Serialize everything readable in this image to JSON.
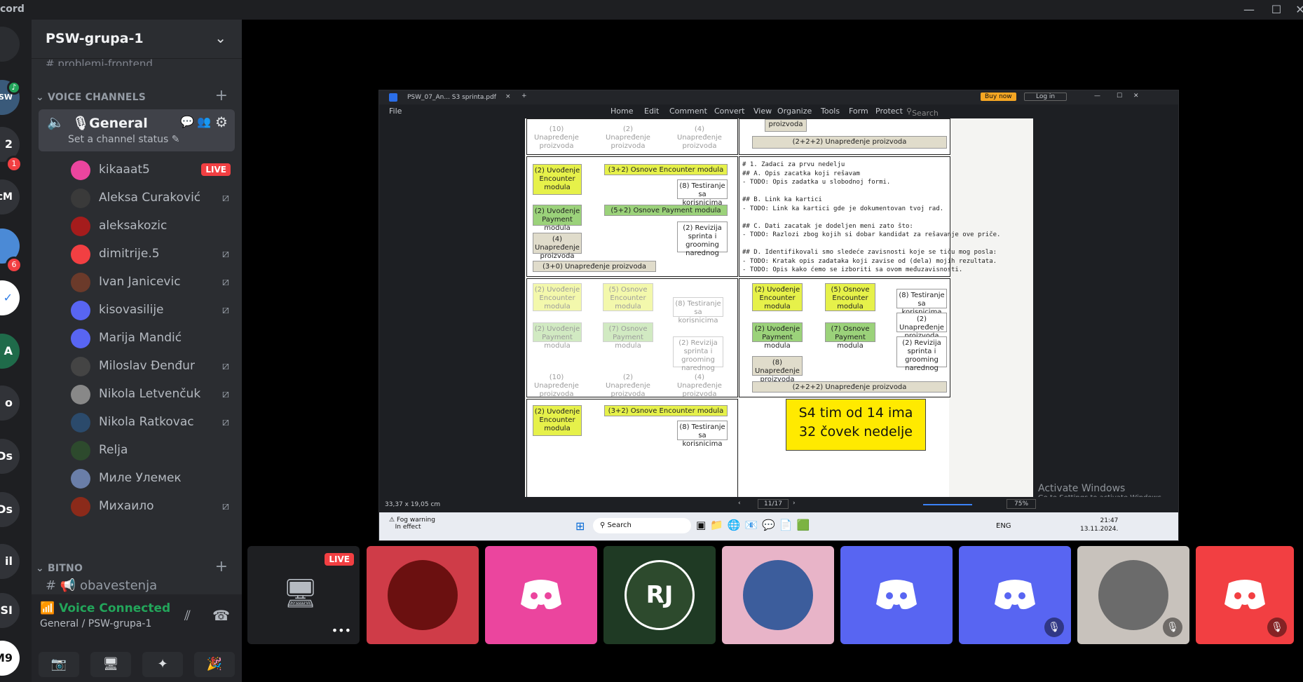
{
  "app": {
    "title": "cord"
  },
  "window_controls": {
    "min": "—",
    "max": "☐",
    "close": "✕"
  },
  "servers": [
    {
      "label": "SW",
      "badge": ""
    },
    {
      "label": "2",
      "badge": "1"
    },
    {
      "label": "McM",
      "badge": ""
    },
    {
      "label": "",
      "badge": "6"
    },
    {
      "label": "",
      "badge": ""
    },
    {
      "label": "A",
      "badge": ""
    },
    {
      "label": "o",
      "badge": ""
    },
    {
      "label": "Ds",
      "badge": ""
    },
    {
      "label": "Ds",
      "badge": ""
    },
    {
      "label": "il",
      "badge": ""
    },
    {
      "label": "SI",
      "badge": ""
    },
    {
      "label": "M9",
      "badge": ""
    }
  ],
  "guild": {
    "name": "PSW-grupa-1",
    "partial_channel": "problemi-frontend"
  },
  "voice_category": "VOICE CHANNELS",
  "voice_channel": {
    "name": "General",
    "status_placeholder": "Set a channel status"
  },
  "members": [
    {
      "name": "kikaaat5",
      "live": "LIVE",
      "muted": false,
      "color": "#eb459e"
    },
    {
      "name": "Aleksa Curaković",
      "live": "",
      "muted": true,
      "color": "#3a3a3a"
    },
    {
      "name": "aleksakozic",
      "live": "",
      "muted": false,
      "color": "#a51c1c"
    },
    {
      "name": "dimitrije.5",
      "live": "",
      "muted": true,
      "color": "#f23f42"
    },
    {
      "name": "Ivan Janicevic",
      "live": "",
      "muted": true,
      "color": "#6b3a2a"
    },
    {
      "name": "kisovasilije",
      "live": "",
      "muted": true,
      "color": "#5865f2"
    },
    {
      "name": "Marija Mandić",
      "live": "",
      "muted": false,
      "color": "#5865f2"
    },
    {
      "name": "Miloslav Đenđur",
      "live": "",
      "muted": true,
      "color": "#444"
    },
    {
      "name": "Nikola Letvenčuk",
      "live": "",
      "muted": true,
      "color": "#888"
    },
    {
      "name": "Nikola Ratkovac",
      "live": "",
      "muted": true,
      "color": "#2b4a6b"
    },
    {
      "name": "Relja",
      "live": "",
      "muted": false,
      "color": "#2d4a2d"
    },
    {
      "name": "Миле Улемек",
      "live": "",
      "muted": false,
      "color": "#6a7ea8"
    },
    {
      "name": "Михаило",
      "live": "",
      "muted": true,
      "color": "#8b2a1a"
    }
  ],
  "bitno_category": "BITNO",
  "bitno_channel": "obavestenja",
  "voice_panel": {
    "title": "Voice Connected",
    "subtitle": "General / PSW-grupa-1"
  },
  "pdf": {
    "tab_title": "PSW_07_An... S3 sprinta.pdf",
    "buy": "Buy now",
    "login": "Log in",
    "file_menu": "File",
    "menu": [
      "Home",
      "Edit",
      "Comment",
      "Convert",
      "View",
      "Organize",
      "Tools",
      "Form",
      "Protect"
    ],
    "search_tools": "Search Tools",
    "dims": "33,37 x 19,05 cm",
    "page": "11/17",
    "zoom": "75%",
    "code_lines": [
      "# 1. Zadaci za prvu nedelju",
      "## A. Opis zacatka koji rešavam",
      "- TODO: Opis zadatka u slobodnoj formi.",
      "",
      "## B. Link ka kartici",
      "- TODO: Link ka kartici gde je dokumentovan tvoj rad.",
      "",
      "## C. Dati zacatak je dodeljen meni zato što:",
      "- TODO: Razlozi zbog kojih si dobar kandidat za rešavanje ove priče.",
      "",
      "## D. Identifikovali smo sledeće zavisnosti koje se tiču mog posla:",
      "- TODO: Kratak opis zadataka koji zavise od (dela) mojih rezultata.",
      "- TODO: Opis kako ćemo se izboriti sa ovom međuzavisnosti."
    ],
    "boxes": {
      "uvodjenje_enc": "(2) Uvođenje Encounter modula",
      "uvodjenje_pay": "(2) Uvođenje Payment modula",
      "unapredjenje": "(4) Unapređenje proizvoda",
      "osnove_enc": "(3+2) Osnove Encounter modula",
      "osnove_pay": "(5+2) Osnove Payment modula",
      "testiranje": "(8) Testiranje sa korisnicima",
      "revizija": "(2) Revizija sprinta i grooming narednog",
      "unapr_bar": "(3+0) Unapređenje proizvoda",
      "unapr_10": "(10) Unapređenje proizvoda",
      "unapr_2": "(2) Unapređenje proizvoda",
      "unapr_4": "(4) Unapređenje proizvoda",
      "unapr_222": "(2+2+2) Unapređenje proizvoda",
      "osnove5": "(5) Osnove Encounter modula",
      "osnove7": "(7) Osnove Payment modula",
      "unapr_8": "(8) Unapređenje proizvoda",
      "proizvoda": "proizvoda"
    },
    "big_line1": "S4 tim od 14 ima",
    "big_line2": "32 čovek nedelje"
  },
  "taskbar": {
    "weather_title": "Fog warning",
    "weather_sub": "In effect",
    "search": "Search",
    "lang": "ENG",
    "time": "21:47",
    "date": "13.11.2024."
  },
  "activate": {
    "title": "Activate Windows",
    "sub": "Go to Settings to activate Windows."
  },
  "tiles": {
    "live": "LIVE"
  }
}
